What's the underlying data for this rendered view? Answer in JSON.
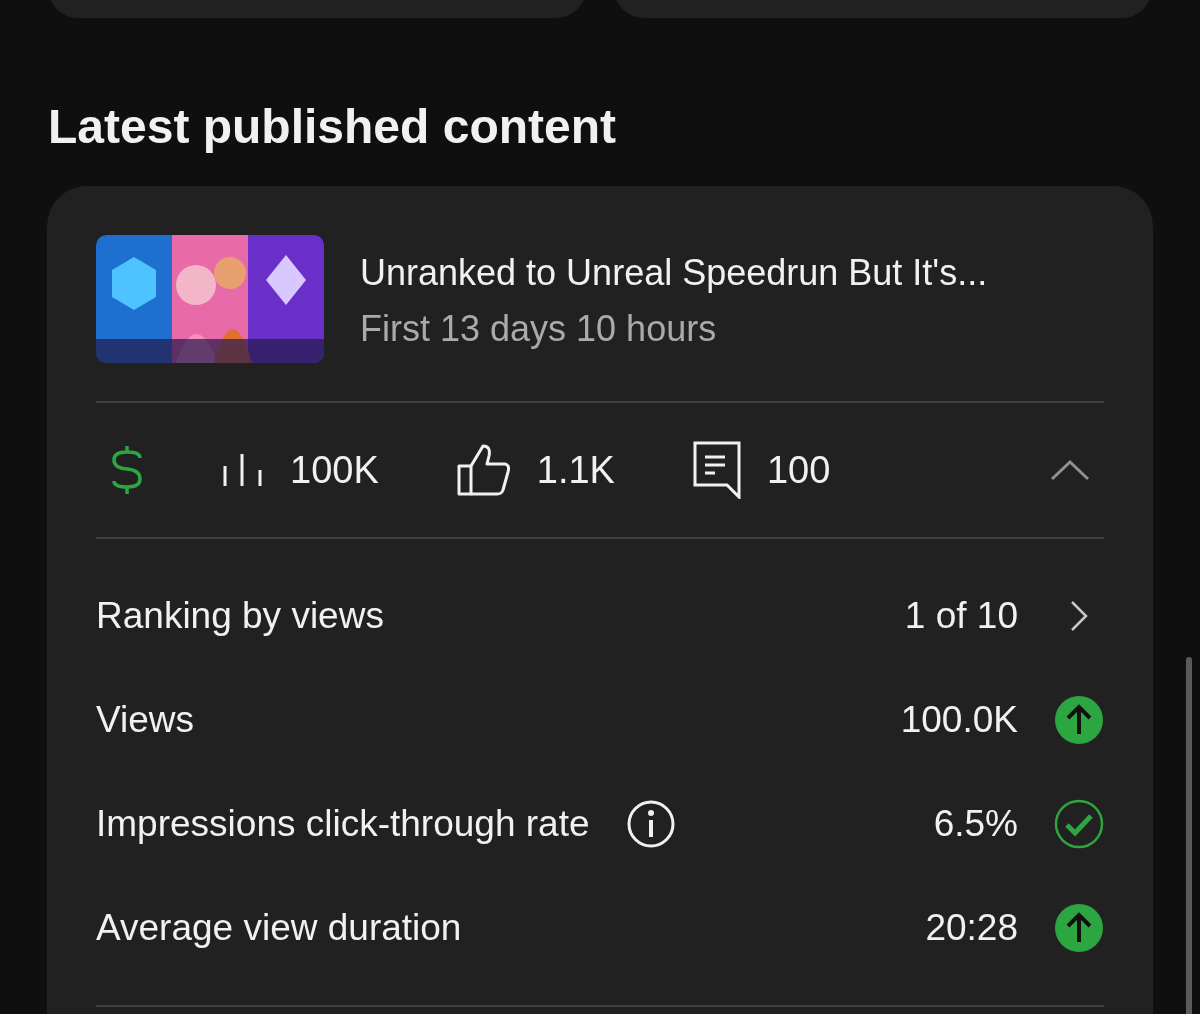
{
  "heading": "Latest published content",
  "content": {
    "title": "Unranked to Unreal Speedrun But It's...",
    "subtitle": "First 13 days 10 hours",
    "stats": [
      {
        "kind": "money"
      },
      {
        "kind": "views",
        "value": "100K"
      },
      {
        "kind": "likes",
        "value": "1.1K"
      },
      {
        "kind": "comments",
        "value": "100"
      }
    ],
    "expanded": true,
    "metrics": [
      {
        "label": "Ranking by views",
        "value": "1 of 10",
        "info": false,
        "kind": "link"
      },
      {
        "label": "Views",
        "value": "100.0K",
        "info": false,
        "kind": "up"
      },
      {
        "label": "Impressions click-through rate",
        "value": "6.5%",
        "info": true,
        "kind": "ok"
      },
      {
        "label": "Average view duration",
        "value": "20:28",
        "info": false,
        "kind": "up"
      }
    ]
  }
}
